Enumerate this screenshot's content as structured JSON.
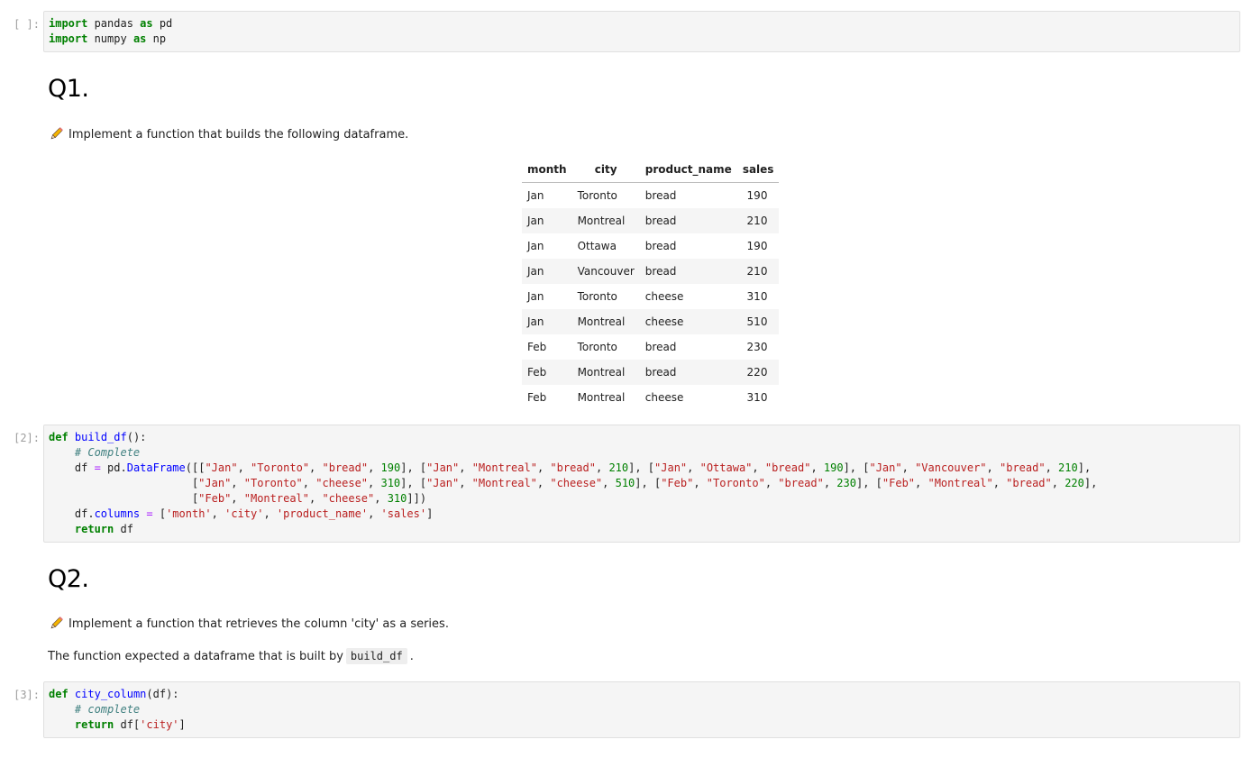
{
  "cells": {
    "imports": {
      "prompt": "[ ]:",
      "lines": [
        "import pandas as pd",
        "import numpy as np"
      ]
    },
    "q1": {
      "heading": "Q1.",
      "instruction": "Implement a function that builds the following dataframe."
    },
    "table": {
      "columns": [
        "month",
        "city",
        "product_name",
        "sales"
      ],
      "rows": [
        [
          "Jan",
          "Toronto",
          "bread",
          "190"
        ],
        [
          "Jan",
          "Montreal",
          "bread",
          "210"
        ],
        [
          "Jan",
          "Ottawa",
          "bread",
          "190"
        ],
        [
          "Jan",
          "Vancouver",
          "bread",
          "210"
        ],
        [
          "Jan",
          "Toronto",
          "cheese",
          "310"
        ],
        [
          "Jan",
          "Montreal",
          "cheese",
          "510"
        ],
        [
          "Feb",
          "Toronto",
          "bread",
          "230"
        ],
        [
          "Feb",
          "Montreal",
          "bread",
          "220"
        ],
        [
          "Feb",
          "Montreal",
          "cheese",
          "310"
        ]
      ]
    },
    "build_df": {
      "prompt": "[2]:",
      "lines": [
        "def build_df():",
        "    # Complete",
        "    df = pd.DataFrame([[\"Jan\", \"Toronto\", \"bread\", 190], [\"Jan\", \"Montreal\", \"bread\", 210], [\"Jan\", \"Ottawa\", \"bread\", 190], [\"Jan\", \"Vancouver\", \"bread\", 210],",
        "                      [\"Jan\", \"Toronto\", \"cheese\", 310], [\"Jan\", \"Montreal\", \"cheese\", 510], [\"Feb\", \"Toronto\", \"bread\", 230], [\"Feb\", \"Montreal\", \"bread\", 220],",
        "                      [\"Feb\", \"Montreal\", \"cheese\", 310]])",
        "    df.columns = ['month', 'city', 'product_name', 'sales']",
        "    return df"
      ]
    },
    "q2": {
      "heading": "Q2.",
      "instruction": "Implement a function that retrieves the column 'city' as a series.",
      "expect_prefix": "The function expected a dataframe that is built by",
      "expect_code": "build_df",
      "expect_suffix": "."
    },
    "city_column": {
      "prompt": "[3]:",
      "lines": [
        "def city_column(df):",
        "    # complete",
        "    return df['city']"
      ]
    }
  },
  "icons": {
    "pencil": "pencil-icon"
  },
  "colors": {
    "keyword": "#008000",
    "string": "#ba2121",
    "comment": "#408080",
    "function": "#0000ff",
    "operator": "#aa22ff"
  }
}
